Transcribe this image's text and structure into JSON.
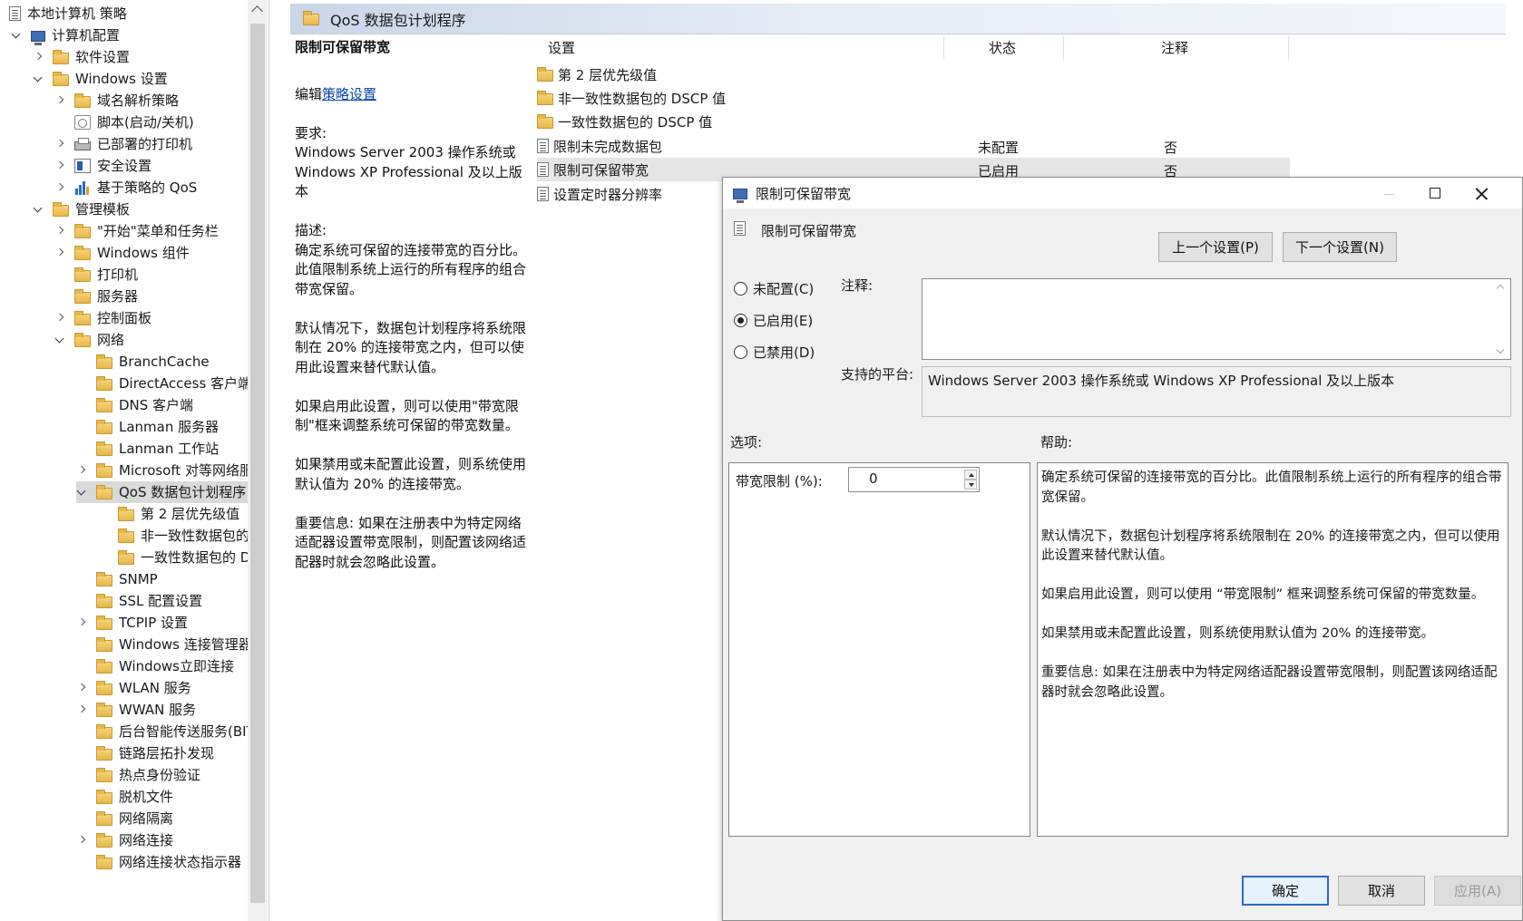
{
  "tree": {
    "items": [
      {
        "label": "本地计算机 策略"
      },
      {
        "label": "计算机配置"
      },
      {
        "label": "软件设置"
      },
      {
        "label": "Windows 设置"
      },
      {
        "label": "域名解析策略"
      },
      {
        "label": "脚本(启动/关机)"
      },
      {
        "label": "已部署的打印机"
      },
      {
        "label": "安全设置"
      },
      {
        "label": "基于策略的 QoS"
      },
      {
        "label": "管理模板"
      },
      {
        "label": "\"开始\"菜单和任务栏"
      },
      {
        "label": "Windows 组件"
      },
      {
        "label": "打印机"
      },
      {
        "label": "服务器"
      },
      {
        "label": "控制面板"
      },
      {
        "label": "网络"
      },
      {
        "label": "BranchCache"
      },
      {
        "label": "DirectAccess 客户端体"
      },
      {
        "label": "DNS 客户端"
      },
      {
        "label": "Lanman 服务器"
      },
      {
        "label": "Lanman 工作站"
      },
      {
        "label": "Microsoft 对等网络服务"
      },
      {
        "label": "QoS 数据包计划程序"
      },
      {
        "label": "第 2 层优先级值"
      },
      {
        "label": "非一致性数据包的 D"
      },
      {
        "label": "一致性数据包的 DS"
      },
      {
        "label": "SNMP"
      },
      {
        "label": "SSL 配置设置"
      },
      {
        "label": "TCPIP 设置"
      },
      {
        "label": "Windows 连接管理器"
      },
      {
        "label": "Windows立即连接"
      },
      {
        "label": "WLAN 服务"
      },
      {
        "label": "WWAN 服务"
      },
      {
        "label": "后台智能传送服务(BITS"
      },
      {
        "label": "链路层拓扑发现"
      },
      {
        "label": "热点身份验证"
      },
      {
        "label": "脱机文件"
      },
      {
        "label": "网络隔离"
      },
      {
        "label": "网络连接"
      },
      {
        "label": "网络连接状态指示器"
      }
    ]
  },
  "path_bar": {
    "title": "QoS 数据包计划程序"
  },
  "description": {
    "title": "限制可保留带宽",
    "edit_prefix": "编辑",
    "edit_link": "策略设置",
    "requirements_label": "要求:",
    "requirements": "Windows Server 2003 操作系统或 Windows XP Professional 及以上版本",
    "desc_label": "描述:",
    "paragraphs": [
      "确定系统可保留的连接带宽的百分比。此值限制系统上运行的所有程序的组合带宽保留。",
      "默认情况下，数据包计划程序将系统限制在 20% 的连接带宽之内，但可以使用此设置来替代默认值。",
      "如果启用此设置，则可以使用\"带宽限制\"框来调整系统可保留的带宽数量。",
      "如果禁用或未配置此设置，则系统使用默认值为 20% 的连接带宽。",
      "重要信息: 如果在注册表中为特定网络适配器设置带宽限制，则配置该网络适配器时就会忽略此设置。"
    ]
  },
  "list": {
    "headers": {
      "setting": "设置",
      "state": "状态",
      "comment": "注释"
    },
    "rows": [
      {
        "name": "第 2 层优先级值",
        "state": "",
        "comment": ""
      },
      {
        "name": "非一致性数据包的 DSCP 值",
        "state": "",
        "comment": ""
      },
      {
        "name": "一致性数据包的 DSCP 值",
        "state": "",
        "comment": ""
      },
      {
        "name": "限制未完成数据包",
        "state": "未配置",
        "comment": "否"
      },
      {
        "name": "限制可保留带宽",
        "state": "已启用",
        "comment": "否"
      },
      {
        "name": "设置定时器分辨率",
        "state": "",
        "comment": ""
      }
    ]
  },
  "dialog": {
    "title": "限制可保留带宽",
    "setting_name": "限制可保留带宽",
    "prev_button": "上一个设置(P)",
    "next_button": "下一个设置(N)",
    "radio_not_configured": "未配置(C)",
    "radio_enabled": "已启用(E)",
    "radio_disabled": "已禁用(D)",
    "selected_radio": "enabled",
    "comment_label": "注释:",
    "comment_value": "",
    "platform_label": "支持的平台:",
    "platform_value": "Windows Server 2003 操作系统或 Windows XP Professional 及以上版本",
    "options_label": "选项:",
    "help_label": "帮助:",
    "bandwidth_label": "带宽限制 (%):",
    "bandwidth_value": "0",
    "help_paragraphs": [
      "确定系统可保留的连接带宽的百分比。此值限制系统上运行的所有程序的组合带宽保留。",
      "默认情况下，数据包计划程序将系统限制在 20% 的连接带宽之内，但可以使用此设置来替代默认值。",
      "如果启用此设置，则可以使用 “带宽限制” 框来调整系统可保留的带宽数量。",
      "如果禁用或未配置此设置，则系统使用默认值为 20% 的连接带宽。",
      "重要信息: 如果在注册表中为特定网络适配器设置带宽限制，则配置该网络适配器时就会忽略此设置。"
    ],
    "ok_button": "确定",
    "cancel_button": "取消",
    "apply_button": "应用(A)"
  }
}
